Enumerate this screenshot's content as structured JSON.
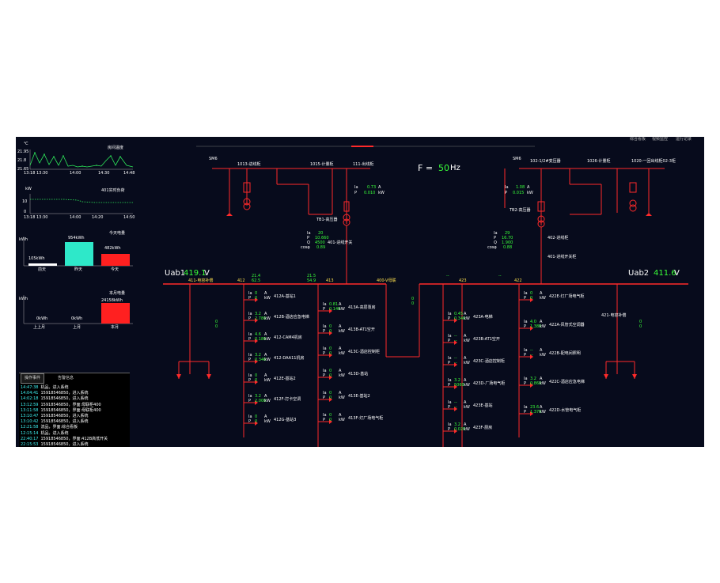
{
  "temp_chart": {
    "title": "房间温度",
    "unit": "℃",
    "y_ticks": [
      "21.95",
      "21.8",
      "21.65"
    ],
    "x_ticks": [
      "13:18",
      "13:30",
      "14:00",
      "14:30",
      "14:48"
    ]
  },
  "load_chart": {
    "title": "401实时负荷",
    "unit": "kW",
    "y_ticks": [
      "10",
      "0"
    ],
    "x_ticks": [
      "13:18",
      "13:30",
      "14:00",
      "14:20",
      "14:50"
    ]
  },
  "today_chart": {
    "title": "今天电量",
    "unit": "kWh",
    "bars": [
      {
        "label": "105kWh",
        "day": "前天",
        "value": 105,
        "color": "#ffffff"
      },
      {
        "label": "954kWh",
        "day": "昨天",
        "value": 954,
        "color": "#2ee8c9"
      },
      {
        "label": "482kWh",
        "day": "今天",
        "value": 482,
        "color": "#ff2020"
      }
    ]
  },
  "month_chart": {
    "title": "本月电量",
    "unit": "kWh",
    "bars": [
      {
        "label": "0kWh",
        "day": "上上月",
        "value": 0,
        "color": "#ffffff"
      },
      {
        "label": "0kWh",
        "day": "上月",
        "value": 0,
        "color": "#2ee8c9"
      },
      {
        "label": "24158kWh",
        "day": "本月",
        "value": 24158,
        "color": "#ff2020"
      }
    ]
  },
  "log": {
    "tabs": [
      "操作事件",
      "告警信息"
    ],
    "rows": [
      {
        "time": "14:47:38",
        "text": "机品，进入系统"
      },
      {
        "time": "14:04:41",
        "text": "15918546850，进入系统"
      },
      {
        "time": "14:02:18",
        "text": "15918546850，进入系统"
      },
      {
        "time": "13:12:59",
        "text": "15918546850，界面:母联柜400"
      },
      {
        "time": "13:11:58",
        "text": "15918546850，界面:母联柜400"
      },
      {
        "time": "13:10:47",
        "text": "15918546850，进入系统"
      },
      {
        "time": "13:10:42",
        "text": "15918546850，进入系统"
      },
      {
        "time": "12:21:58",
        "text": "流品，界面:综合看板"
      },
      {
        "time": "12:15:14",
        "text": "机品，进入系统"
      },
      {
        "time": "22:40:17",
        "text": "15918546850，界面:412B高低开关"
      },
      {
        "time": "22:15:53",
        "text": "15918546850，进入系统"
      }
    ]
  },
  "top_right_menu": [
    "综合看板",
    "视频监控",
    "运行记录"
  ],
  "frequency": {
    "label": "F =",
    "value": "50",
    "unit": "Hz"
  },
  "bus_left": {
    "label": "Uab1",
    "value": "419.1",
    "unit": "V"
  },
  "bus_right": {
    "label": "Uab2",
    "value": "411.6",
    "unit": "V"
  },
  "sm6_left": "SM6",
  "sm6_right": "SM6",
  "hv_left_labels": [
    "1013-进线柜",
    "1015-计量柜",
    "111-出线柜"
  ],
  "hv_right_labels": [
    "102-1/2#变压器",
    "1026-计量柜",
    "1020-一回出线柜02-3柜"
  ],
  "transformer_left": {
    "name": "TB1-高压器",
    "ia": "0.73",
    "p": "0.010",
    "ia_unit": "A",
    "p_unit": "kW"
  },
  "transformer_right": {
    "name": "TB2-高压器",
    "ia": "1.08",
    "p": "0.015",
    "ia_unit": "A",
    "p_unit": "kW"
  },
  "incoming_left": {
    "name": "401-进线开关",
    "ia": "20",
    "p": "10.660",
    "q": "4500",
    "cos": "0.89"
  },
  "incoming_right": {
    "name": "402-进线柜",
    "ia": "29",
    "p": "16.70",
    "q": "1.900",
    "cos": "0.88"
  },
  "cap_left": {
    "name": "411-电容补偿",
    "temp": "21.4",
    "pct": "62.5"
  },
  "cap_mid": {
    "name": "412",
    "temp": "21.5",
    "pct": "54.9"
  },
  "bus_tie": {
    "name": "400-V母联",
    "ia": "0",
    "p": "0",
    "label413": "413"
  },
  "cap_right": {
    "name": "423",
    "name2": "422",
    "temp": "--",
    "pct": "--"
  },
  "tie_right_name": "401-进线开关柜",
  "feeders_412": [
    {
      "name": "412A-基站1",
      "ia": "0",
      "p": "0"
    },
    {
      "name": "412B-酒店应急电梯",
      "ia": "3.2",
      "p": "2.780"
    },
    {
      "name": "412-CAM4机房",
      "ia": "4.6",
      "p": "0.180"
    },
    {
      "name": "412-DAA11机房",
      "ia": "3.2",
      "p": "0.340"
    },
    {
      "name": "412E-基站2",
      "ia": "0",
      "p": "0"
    },
    {
      "name": "412F-打卡空调",
      "ia": "3.2",
      "p": "2.000"
    },
    {
      "name": "412G-基站3",
      "ia": "0",
      "p": "0"
    }
  ],
  "feeders_413": [
    {
      "name": "413A-高层泵房",
      "ia": "0.81",
      "p": "0.140"
    },
    {
      "name": "413B-AT1空开",
      "ia": "0",
      "p": "0"
    },
    {
      "name": "413C-酒店控制柜",
      "ia": "0",
      "p": "0"
    },
    {
      "name": "413D-基站",
      "ia": "0",
      "p": "0"
    },
    {
      "name": "413E-基站2",
      "ia": "0",
      "p": "0"
    },
    {
      "name": "413F-灯厂场电气柜",
      "ia": "0",
      "p": "0"
    }
  ],
  "feeders_423": [
    {
      "name": "423A-电梯",
      "ia": "0.45",
      "p": "0.340"
    },
    {
      "name": "423B-AT1空开",
      "ia": "--",
      "p": "--"
    },
    {
      "name": "423C-酒店控制柜",
      "ia": "--",
      "p": "--"
    },
    {
      "name": "423D-厂场电气柜",
      "ia": "3.2",
      "p": "5060"
    },
    {
      "name": "423E-基站",
      "ia": "--",
      "p": "--"
    },
    {
      "name": "423F-厨房",
      "ia": "3.2",
      "p": "0.020"
    }
  ],
  "feeders_422": [
    {
      "name": "422E-灯厂场电气柜",
      "ia": "0",
      "p": "0"
    },
    {
      "name": "422A-风管式空调器",
      "ia": "4.0",
      "p": "1.380"
    },
    {
      "name": "422B-配电间照明",
      "ia": "--",
      "p": "--"
    },
    {
      "name": "422C-酒店应急电梯",
      "ia": "3.2",
      "p": "0.860"
    },
    {
      "name": "422D-水管电气柜",
      "ia": "23.6",
      "p": "1.370"
    }
  ],
  "right_cap": {
    "name": "421-电容补偿",
    "ia": "0",
    "p": "0"
  },
  "left_cap_meter": {
    "ia": "0",
    "p": "0"
  },
  "tie_meter": {
    "ia": "0",
    "p": "0"
  },
  "mid_temp": {
    "t1": "21.5",
    "t1_unit": "℃",
    "t2": "--",
    "t2_unit": "℃"
  }
}
